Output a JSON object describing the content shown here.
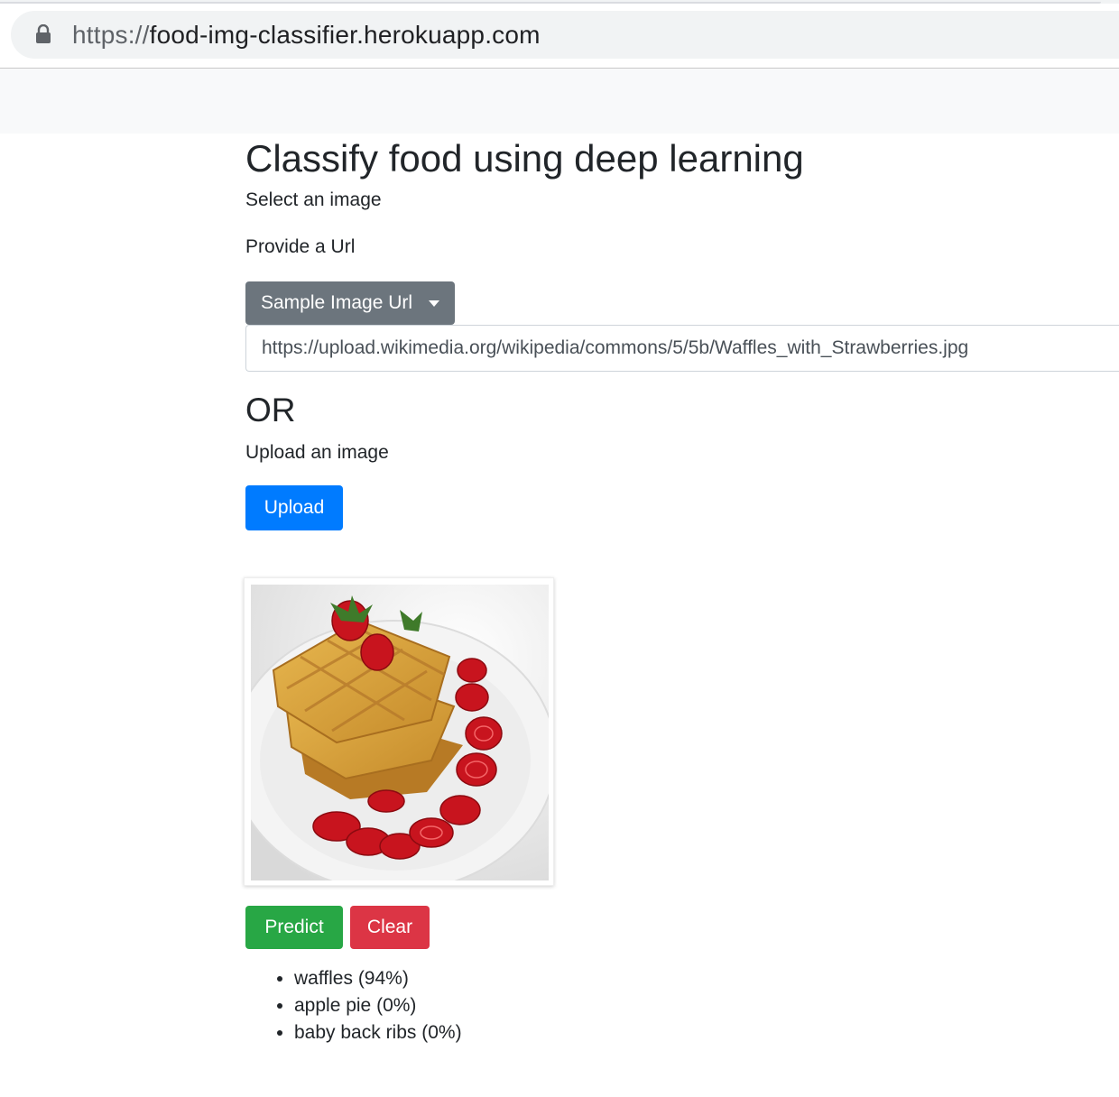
{
  "browser": {
    "url_protocol": "https://",
    "url_host": "food-img-classifier.herokuapp.com",
    "lock_icon": "lock-icon"
  },
  "main": {
    "title": "Classify food using deep learning",
    "select_label": "Select an image",
    "provide_url_label": "Provide a Url",
    "sample_button_label": "Sample Image Url",
    "url_value": "https://upload.wikimedia.org/wikipedia/commons/5/5b/Waffles_with_Strawberries.jpg",
    "or_heading": "OR",
    "upload_label": "Upload an image",
    "upload_button_label": "Upload",
    "predict_button_label": "Predict",
    "clear_button_label": "Clear"
  },
  "predictions": [
    "waffles (94%)",
    "apple pie (0%)",
    "baby back ribs (0%)"
  ],
  "colors": {
    "secondary": "#6c757d",
    "primary": "#007bff",
    "success": "#28a745",
    "danger": "#dc3545",
    "navbar": "#f8f9fa"
  }
}
